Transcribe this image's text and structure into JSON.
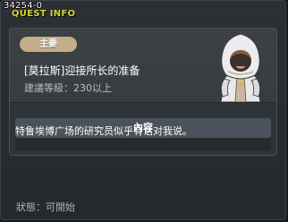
{
  "window": {
    "id": "34254-0",
    "title": "QUEST INFO"
  },
  "quest": {
    "category": "主要",
    "name": "[莫拉斯]迎接所长的准备",
    "level_requirement": "建議等級：230以上"
  },
  "content": {
    "header": "內容",
    "text": "特鲁埃博广场的研究员似乎有话对我说。"
  },
  "status": "狀態：可開始",
  "colors": {
    "title": "#d8d22b",
    "badge": "#c3ad8a",
    "panel": "#2f3438",
    "content_header": "#4a535b"
  }
}
